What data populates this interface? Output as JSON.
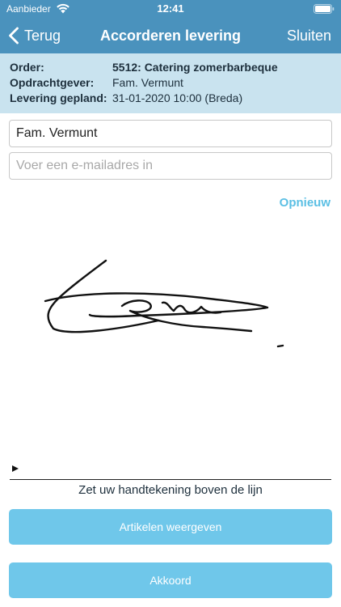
{
  "status_bar": {
    "carrier": "Aanbieder",
    "time": "12:41"
  },
  "nav": {
    "back_label": "Terug",
    "title": "Accorderen levering",
    "close_label": "Sluiten"
  },
  "info": {
    "order_label": "Order:",
    "order_value": "5512: Catering zomerbarbeque",
    "client_label": "Opdrachtgever:",
    "client_value": "Fam. Vermunt",
    "planned_label": "Levering gepland:",
    "planned_value": "31-01-2020 10:00 (Breda)"
  },
  "form": {
    "name_value": "Fam. Vermunt",
    "email_value": "",
    "email_placeholder": "Voer een e-mailadres in"
  },
  "signature": {
    "reset_label": "Opnieuw",
    "hint": "Zet uw handtekening boven de lijn"
  },
  "buttons": {
    "articles_label": "Artikelen weergeven",
    "accept_label": "Akkoord"
  },
  "colors": {
    "nav_bar": "#4a92bd",
    "info_panel": "#c9e3ef",
    "accent": "#5bbfe4",
    "button": "#6fc7ea"
  }
}
